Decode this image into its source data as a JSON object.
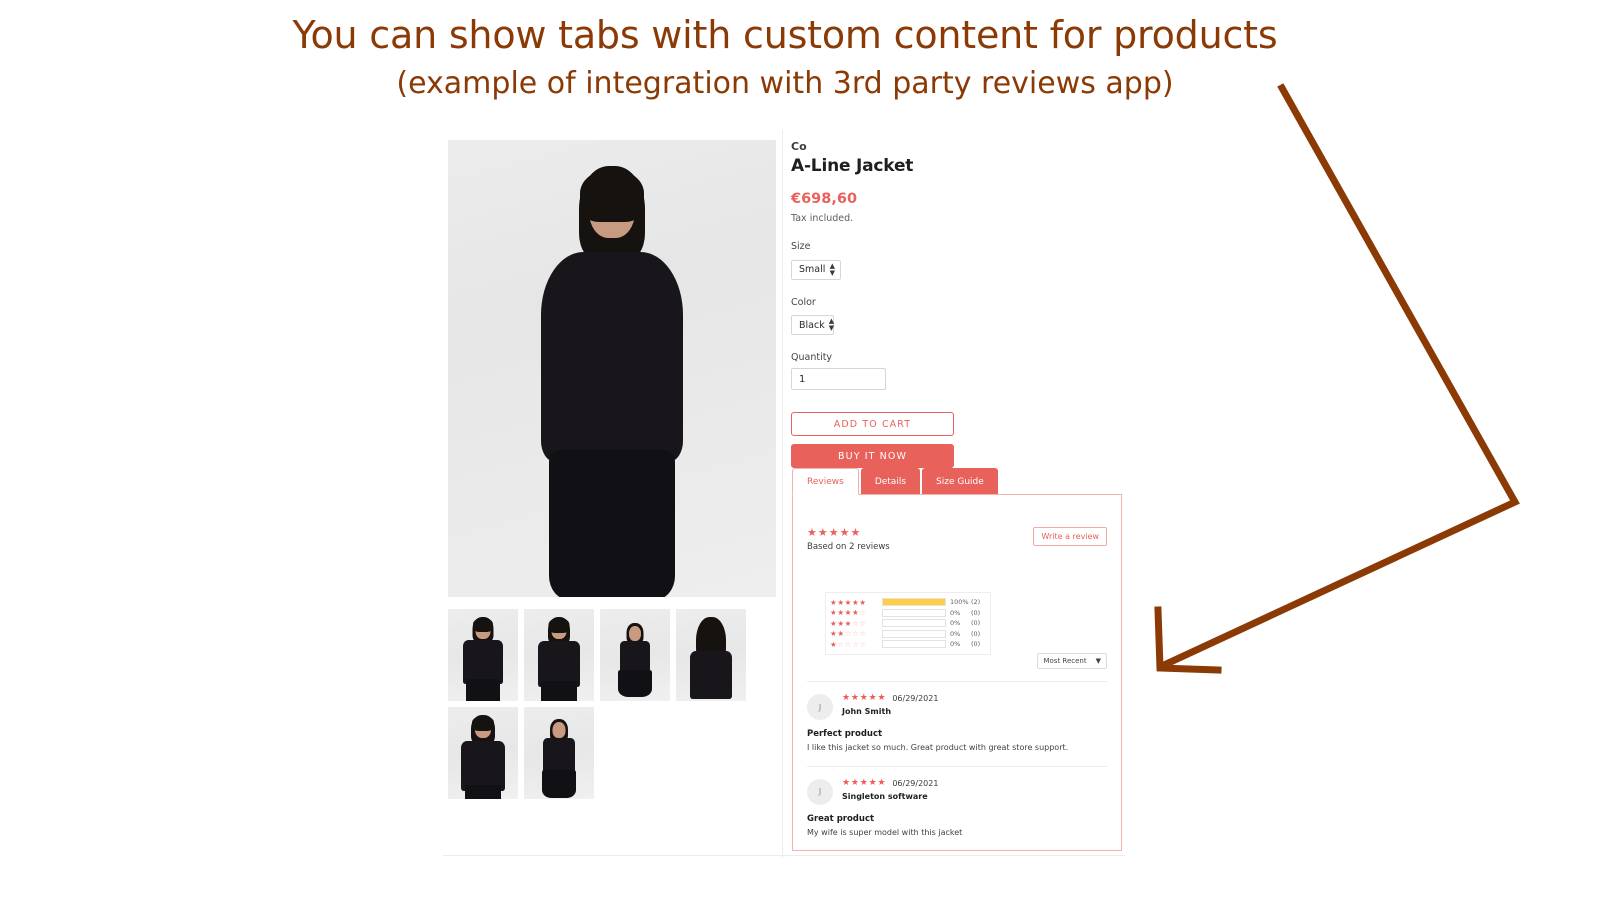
{
  "annotation": {
    "headline": "You can show tabs with custom content for products",
    "subheadline": "(example of integration with 3rd party reviews app)",
    "color": "#8B3A06"
  },
  "product": {
    "vendor": "Co",
    "title": "A-Line Jacket",
    "price": "€698,60",
    "tax_note": "Tax included.",
    "options": [
      {
        "label": "Size",
        "value": "Small"
      },
      {
        "label": "Color",
        "value": "Black"
      }
    ],
    "quantity": {
      "label": "Quantity",
      "value": "1"
    },
    "add_to_cart_label": "ADD TO CART",
    "buy_now_label": "BUY IT NOW",
    "accent_color": "#e8615a"
  },
  "gallery": {
    "main_alt": "Model wearing black A-Line Jacket",
    "thumbnail_count": 6
  },
  "tabs": [
    {
      "label": "Reviews",
      "active": true
    },
    {
      "label": "Details",
      "active": false
    },
    {
      "label": "Size Guide",
      "active": false
    }
  ],
  "reviews": {
    "summary": {
      "stars": "★★★★★",
      "based_on": "Based on 2 reviews",
      "write_review_label": "Write a review"
    },
    "histogram": [
      {
        "stars_on": 5,
        "stars_off": 0,
        "percent": "100%",
        "count": "(2)",
        "fill": 100
      },
      {
        "stars_on": 4,
        "stars_off": 1,
        "percent": "0%",
        "count": "(0)",
        "fill": 0
      },
      {
        "stars_on": 3,
        "stars_off": 2,
        "percent": "0%",
        "count": "(0)",
        "fill": 0
      },
      {
        "stars_on": 2,
        "stars_off": 3,
        "percent": "0%",
        "count": "(0)",
        "fill": 0
      },
      {
        "stars_on": 1,
        "stars_off": 4,
        "percent": "0%",
        "count": "(0)",
        "fill": 0
      }
    ],
    "bar_fill_color": "#ffce44",
    "sort": {
      "value": "Most Recent",
      "caret": "▼"
    },
    "items": [
      {
        "avatar_initial": "J",
        "stars": "★★★★★",
        "date": "06/29/2021",
        "author": "John Smith",
        "title": "Perfect product",
        "body": "I like this jacket so much. Great product with great store support."
      },
      {
        "avatar_initial": "J",
        "stars": "★★★★★",
        "date": "06/29/2021",
        "author": "Singleton software",
        "title": "Great product",
        "body": "My wife is super model with this jacket"
      }
    ]
  }
}
